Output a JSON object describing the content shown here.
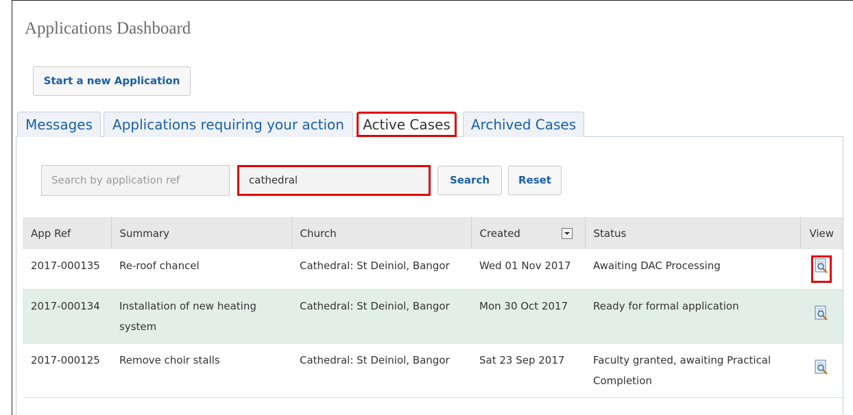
{
  "page": {
    "title": "Applications Dashboard"
  },
  "actions": {
    "start_label": "Start a new Application"
  },
  "tabs": [
    {
      "label": "Messages"
    },
    {
      "label": "Applications requiring your action"
    },
    {
      "label": "Active Cases"
    },
    {
      "label": "Archived Cases"
    }
  ],
  "search": {
    "ref_placeholder": "Search by application ref",
    "text_value": "cathedral",
    "search_label": "Search",
    "reset_label": "Reset"
  },
  "table": {
    "headers": [
      "App Ref",
      "Summary",
      "Church",
      "Created",
      "Status",
      "View"
    ],
    "rows": [
      {
        "ref": "2017-000135",
        "summary": "Re-roof chancel",
        "church": "Cathedral: St Deiniol, Bangor",
        "created": "Wed 01 Nov 2017",
        "status": "Awaiting DAC Processing"
      },
      {
        "ref": "2017-000134",
        "summary": "Installation of new heating system",
        "church": "Cathedral: St Deiniol, Bangor",
        "created": "Mon 30 Oct 2017",
        "status": "Ready for formal application"
      },
      {
        "ref": "2017-000125",
        "summary": "Remove choir stalls",
        "church": "Cathedral: St Deiniol, Bangor",
        "created": "Sat 23 Sep 2017",
        "status": "Faculty granted, awaiting Practical Completion"
      }
    ]
  },
  "colors": {
    "link": "#1a5fa8",
    "highlight": "#e00000",
    "alt_row": "#e2efe9",
    "header_bg": "#e8e8e8"
  },
  "icons": {
    "view": "magnifier-document-icon",
    "sort": "chevron-down-icon"
  }
}
